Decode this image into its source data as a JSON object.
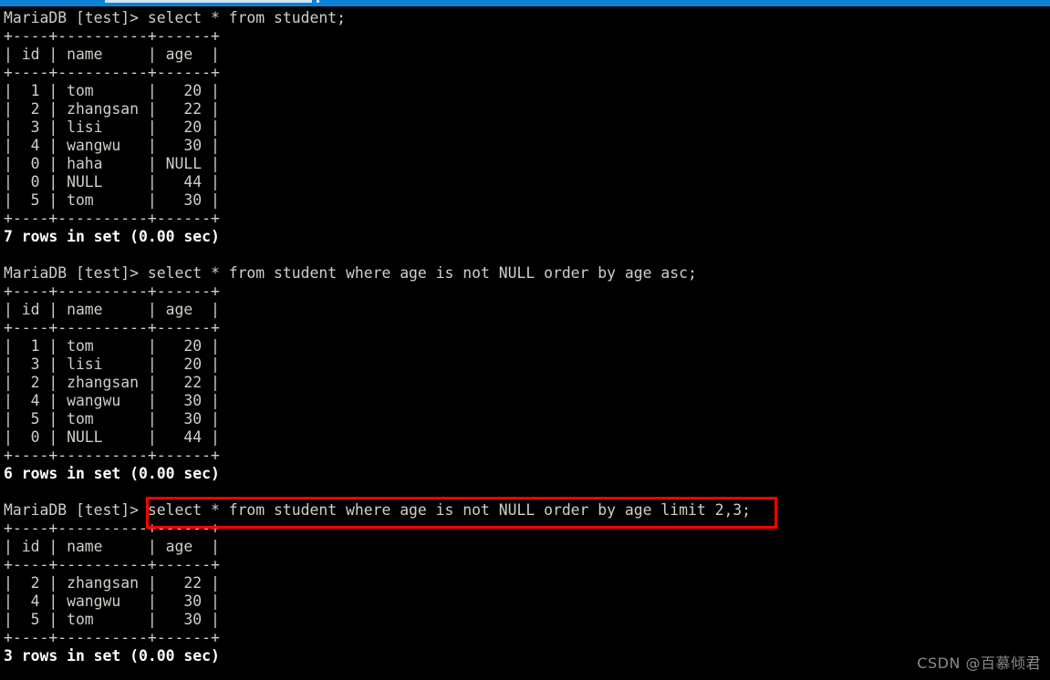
{
  "window": {
    "titlebar_color": "#0b82d4",
    "titlebar_tab_color": "#cfe6f7"
  },
  "terminal": {
    "background_color": "#000000",
    "foreground_color": "#cfcfc7",
    "bold_color": "#ffffff",
    "prompt": "MariaDB [test]> ",
    "table_separator": "+----+----------+------+",
    "table_header": "| id | name     | age  |"
  },
  "annotation": {
    "box_color": "#ff0000",
    "highlighted_command": "select * from student where age is not NULL order by age limit 2,3;"
  },
  "watermark": {
    "text": "CSDN @百慕倾君"
  },
  "blocks": [
    {
      "command_line": "MariaDB [test]> select * from student;",
      "command": "select * from student;",
      "columns": [
        "id",
        "name",
        "age"
      ],
      "rows": [
        [
          "1",
          "tom",
          "20"
        ],
        [
          "2",
          "zhangsan",
          "22"
        ],
        [
          "3",
          "lisi",
          "20"
        ],
        [
          "4",
          "wangwu",
          "30"
        ],
        [
          "0",
          "haha",
          "NULL"
        ],
        [
          "0",
          "NULL",
          "44"
        ],
        [
          "5",
          "tom",
          "30"
        ]
      ],
      "status": "7 rows in set (0.00 sec)",
      "highlighted": false
    },
    {
      "command_line": "MariaDB [test]> select * from student where age is not NULL order by age asc;",
      "command": "select * from student where age is not NULL order by age asc;",
      "columns": [
        "id",
        "name",
        "age"
      ],
      "rows": [
        [
          "1",
          "tom",
          "20"
        ],
        [
          "3",
          "lisi",
          "20"
        ],
        [
          "2",
          "zhangsan",
          "22"
        ],
        [
          "4",
          "wangwu",
          "30"
        ],
        [
          "5",
          "tom",
          "30"
        ],
        [
          "0",
          "NULL",
          "44"
        ]
      ],
      "status": "6 rows in set (0.00 sec)",
      "highlighted": false
    },
    {
      "command_line": "MariaDB [test]> select * from student where age is not NULL order by age limit 2,3;",
      "command": "select * from student where age is not NULL order by age limit 2,3;",
      "columns": [
        "id",
        "name",
        "age"
      ],
      "rows": [
        [
          "2",
          "zhangsan",
          "22"
        ],
        [
          "4",
          "wangwu",
          "30"
        ],
        [
          "5",
          "tom",
          "30"
        ]
      ],
      "status": "3 rows in set (0.00 sec)",
      "highlighted": true
    }
  ],
  "rendered_lines": [
    {
      "text": "MariaDB [test]> select * from student;",
      "bold": false
    },
    {
      "text": "+----+----------+------+",
      "bold": false
    },
    {
      "text": "| id | name     | age  |",
      "bold": false
    },
    {
      "text": "+----+----------+------+",
      "bold": false
    },
    {
      "text": "|  1 | tom      |   20 |",
      "bold": false
    },
    {
      "text": "|  2 | zhangsan |   22 |",
      "bold": false
    },
    {
      "text": "|  3 | lisi     |   20 |",
      "bold": false
    },
    {
      "text": "|  4 | wangwu   |   30 |",
      "bold": false
    },
    {
      "text": "|  0 | haha     | NULL |",
      "bold": false
    },
    {
      "text": "|  0 | NULL     |   44 |",
      "bold": false
    },
    {
      "text": "|  5 | tom      |   30 |",
      "bold": false
    },
    {
      "text": "+----+----------+------+",
      "bold": false
    },
    {
      "text": "7 rows in set (0.00 sec)",
      "bold": true
    },
    {
      "text": " ",
      "bold": false
    },
    {
      "text": "MariaDB [test]> select * from student where age is not NULL order by age asc;",
      "bold": false
    },
    {
      "text": "+----+----------+------+",
      "bold": false
    },
    {
      "text": "| id | name     | age  |",
      "bold": false
    },
    {
      "text": "+----+----------+------+",
      "bold": false
    },
    {
      "text": "|  1 | tom      |   20 |",
      "bold": false
    },
    {
      "text": "|  3 | lisi     |   20 |",
      "bold": false
    },
    {
      "text": "|  2 | zhangsan |   22 |",
      "bold": false
    },
    {
      "text": "|  4 | wangwu   |   30 |",
      "bold": false
    },
    {
      "text": "|  5 | tom      |   30 |",
      "bold": false
    },
    {
      "text": "|  0 | NULL     |   44 |",
      "bold": false
    },
    {
      "text": "+----+----------+------+",
      "bold": false
    },
    {
      "text": "6 rows in set (0.00 sec)",
      "bold": true
    },
    {
      "text": " ",
      "bold": false
    },
    {
      "text": "MariaDB [test]> select * from student where age is not NULL order by age limit 2,3;",
      "bold": false
    },
    {
      "text": "+----+----------+------+",
      "bold": false
    },
    {
      "text": "| id | name     | age  |",
      "bold": false
    },
    {
      "text": "+----+----------+------+",
      "bold": false
    },
    {
      "text": "|  2 | zhangsan |   22 |",
      "bold": false
    },
    {
      "text": "|  4 | wangwu   |   30 |",
      "bold": false
    },
    {
      "text": "|  5 | tom      |   30 |",
      "bold": false
    },
    {
      "text": "+----+----------+------+",
      "bold": false
    },
    {
      "text": "3 rows in set (0.00 sec)",
      "bold": true
    }
  ]
}
